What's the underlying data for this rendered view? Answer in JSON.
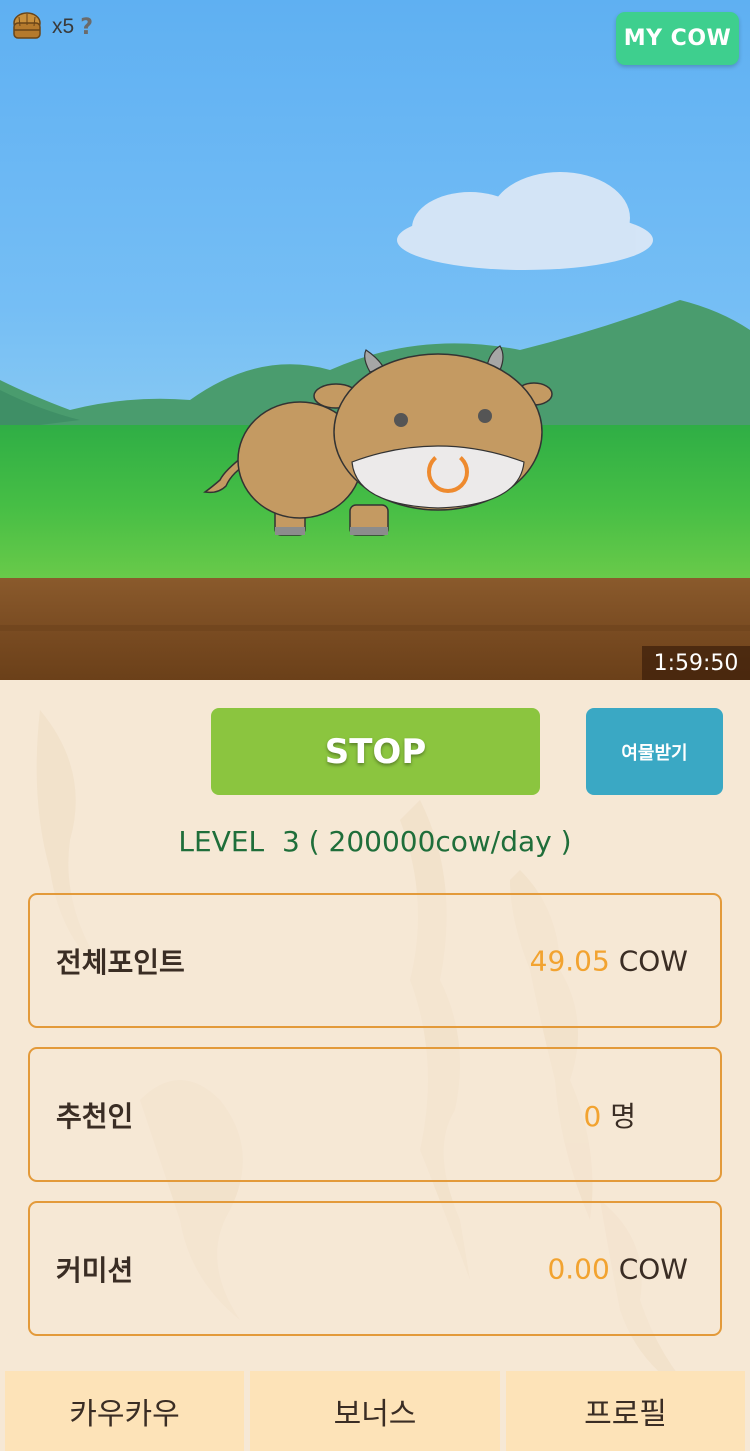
{
  "header": {
    "hay_icon": "hay-bale-icon",
    "hay_count": "x5",
    "help_icon": "help-question-icon",
    "help_glyph": "?",
    "my_cow_button": "MY COW",
    "timer": "1:59:50"
  },
  "actions": {
    "stop_button": "STOP",
    "gift_button": "여물받기"
  },
  "level_text": "LEVEL  3 ( 200000cow/day )",
  "stats": [
    {
      "label": "전체포인트",
      "value": "49.05",
      "unit": "COW"
    },
    {
      "label": "추천인",
      "value": "0",
      "unit": "명"
    },
    {
      "label": "커미션",
      "value": "0.00",
      "unit": "COW"
    }
  ],
  "nav": {
    "tabs": [
      "카우카우",
      "보너스",
      "프로필"
    ]
  },
  "colors": {
    "accent_green": "#8bc53f",
    "my_cow_green": "#3ecf8e",
    "gift_blue": "#3aa8c4",
    "value_orange": "#f2a330",
    "card_border": "#e39a3a",
    "level_text": "#1f6e3a"
  }
}
